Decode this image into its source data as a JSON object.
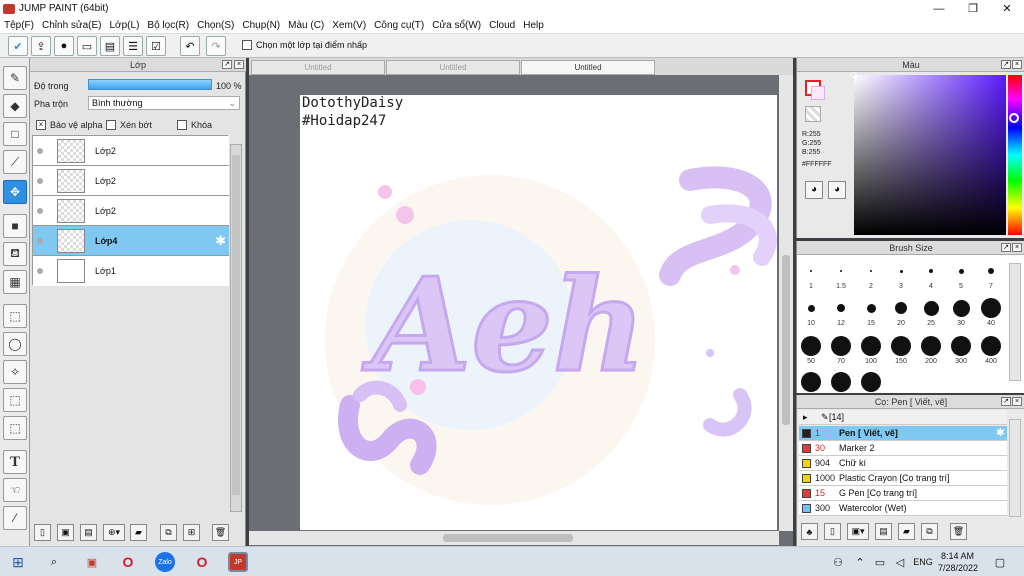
{
  "window": {
    "title": "JUMP PAINT (64bit)",
    "minimize": "—",
    "maximize": "❐",
    "close": "✕"
  },
  "menu": [
    "Tệp(F)",
    "Chỉnh sửa(E)",
    "Lớp(L)",
    "Bộ lọc(R)",
    "Chọn(S)",
    "Chụp(N)",
    "Màu (C)",
    "Xem(V)",
    "Công cụ(T)",
    "Cửa sổ(W)",
    "Cloud",
    "Help"
  ],
  "toolbar": {
    "select_layer_label": "Chọn một lớp tại điểm nhấp"
  },
  "layer_panel": {
    "title": "Lớp",
    "opacity_label": "Độ trong",
    "opacity_value": "100 %",
    "opacity_fraction": 1.0,
    "blend_label": "Pha trộn",
    "blend_value": "Bình thường",
    "protect_alpha": "Bảo vệ alpha",
    "clip": "Xén bớt",
    "lock": "Khóa",
    "layers": [
      {
        "name": "Lớp2"
      },
      {
        "name": "Lớp2"
      },
      {
        "name": "Lớp2"
      },
      {
        "name": "Lớp4",
        "selected": true
      },
      {
        "name": "Lớp1"
      }
    ]
  },
  "tabs": [
    {
      "label": "Untitled"
    },
    {
      "label": "Untitled"
    },
    {
      "label": "Untitled",
      "active": true
    }
  ],
  "canvas": {
    "watermark_line1": "DotothyDaisy",
    "watermark_line2": "#Hoidap247",
    "artwork_text": "Aeh"
  },
  "color_panel": {
    "title": "Màu",
    "r": "R:255",
    "g": "G:255",
    "b": "B:255",
    "hex": "#FFFFFF"
  },
  "brush_size": {
    "title": "Brush Size",
    "sizes": [
      "1",
      "1.5",
      "2",
      "3",
      "4",
      "5",
      "7",
      "10",
      "12",
      "15",
      "20",
      "25",
      "30",
      "40",
      "50",
      "70",
      "100",
      "150",
      "200",
      "300",
      "400"
    ]
  },
  "pen_panel": {
    "title": "Cọ: Pen [ Viết, vẽ]",
    "group_label": "[14]",
    "pens": [
      {
        "size": "1",
        "name": "Pen [ Viết, vẽ]",
        "color": "#222222",
        "selected": true
      },
      {
        "size": "30",
        "name": "Marker 2",
        "color": "#e53935"
      },
      {
        "size": "904",
        "name": "Chữ kí",
        "color": "#f4d400"
      },
      {
        "size": "1000",
        "name": "Plastic Crayon [Cọ trang trí]",
        "color": "#f4d400"
      },
      {
        "size": "15",
        "name": "G Pen [Cọ trang trí]",
        "color": "#e53935"
      },
      {
        "size": "300",
        "name": "Watercolor (Wet)",
        "color": "#6ec6f0"
      }
    ]
  },
  "taskbar": {
    "time": "8:14 AM",
    "date": "7/28/2022",
    "lang": "ENG"
  }
}
